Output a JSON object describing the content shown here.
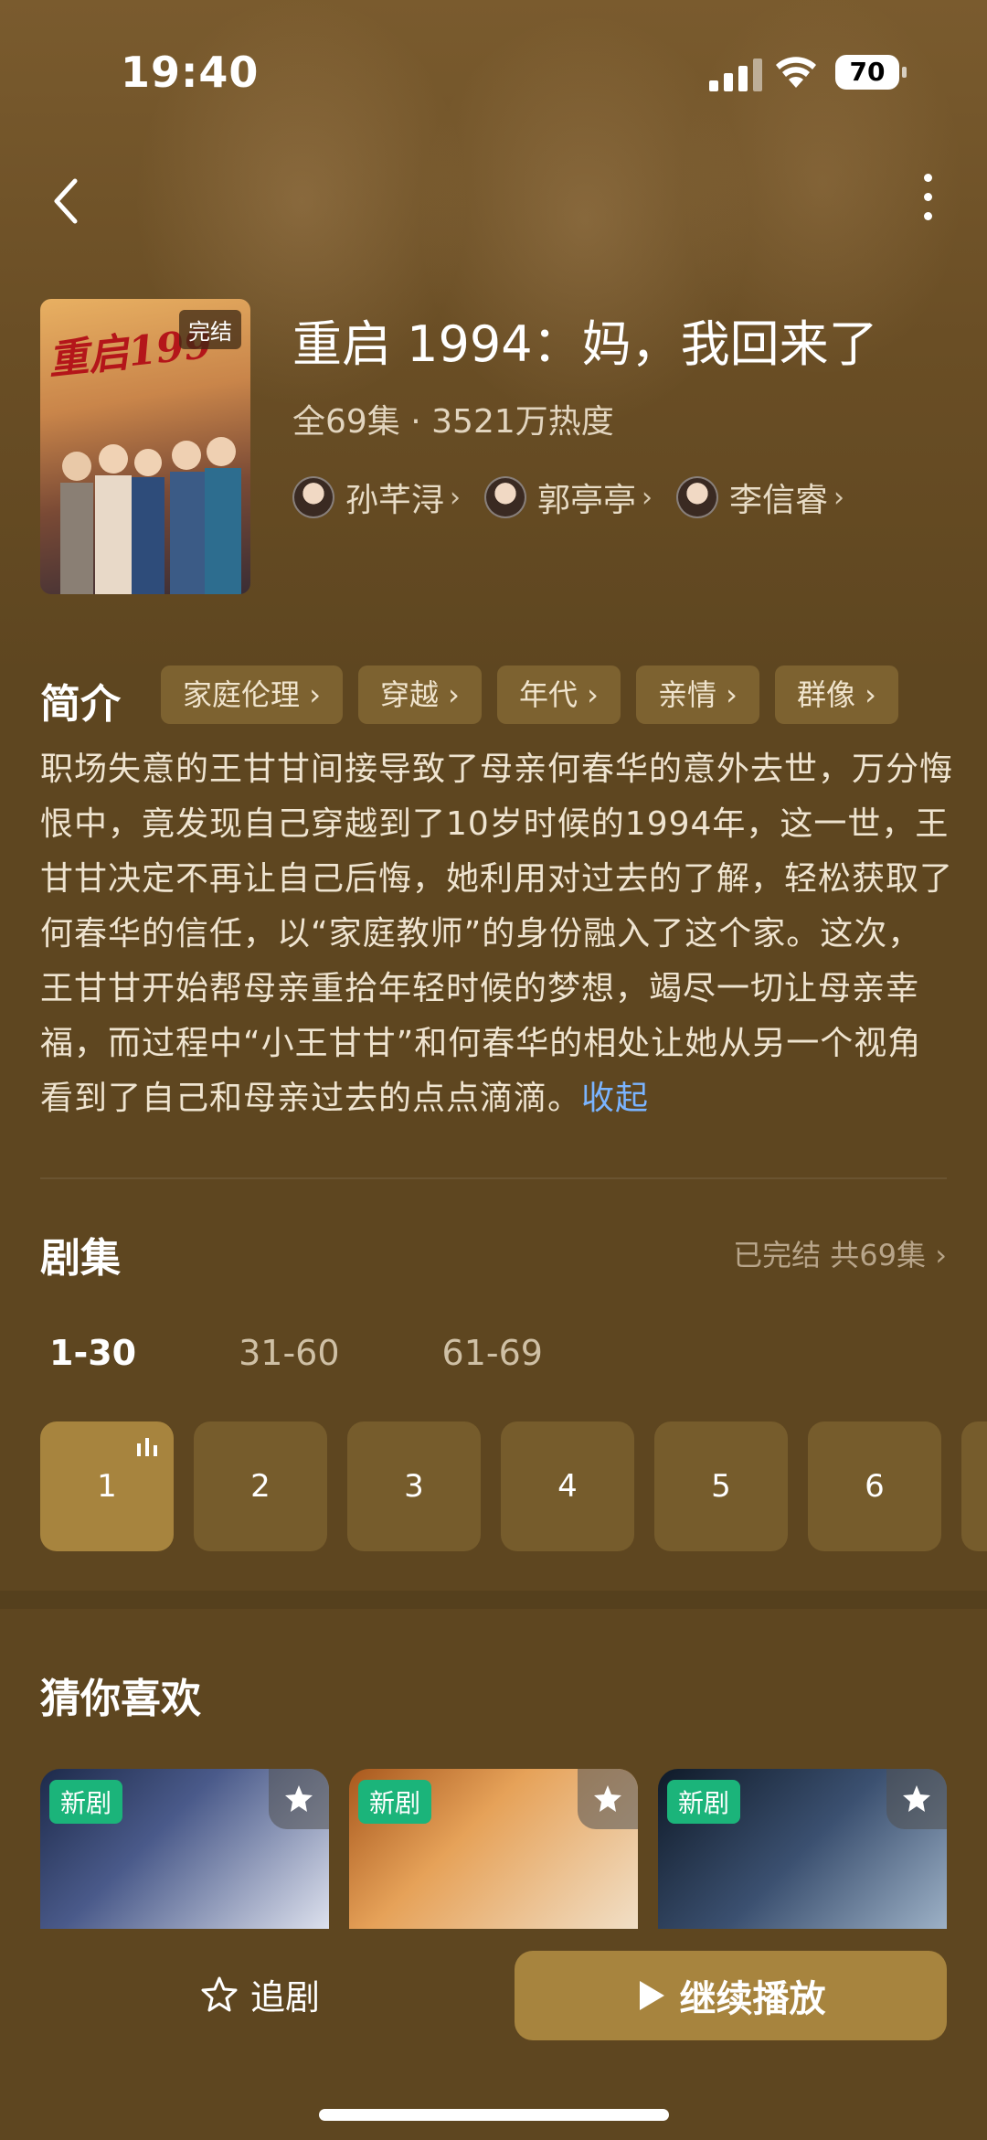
{
  "status_bar": {
    "time": "19:40",
    "battery": "70"
  },
  "drama": {
    "title": "重启 1994：妈，我回来了",
    "meta": "全69集 · 3521万热度",
    "poster_title": "重启199",
    "poster_badge": "完结",
    "cast": [
      {
        "name": "孙芊浔"
      },
      {
        "name": "郭亭亭"
      },
      {
        "name": "李信睿"
      }
    ]
  },
  "synopsis": {
    "label": "简介",
    "tags": [
      "家庭伦理",
      "穿越",
      "年代",
      "亲情",
      "群像"
    ],
    "text": "职场失意的王甘甘间接导致了母亲何春华的意外去世，万分悔恨中，竟发现自己穿越到了10岁时候的1994年，这一世，王甘甘决定不再让自己后悔，她利用对过去的了解，轻松获取了何春华的信任，以“家庭教师”的身份融入了这个家。这次，王甘甘开始帮母亲重拾年轻时候的梦想，竭尽一切让母亲幸福，而过程中“小王甘甘”和何春华的相处让她从另一个视角看到了自己和母亲过去的点点滴滴。",
    "collapse": "收起"
  },
  "episodes": {
    "label": "剧集",
    "status": "已完结 共69集",
    "ranges": [
      "1-30",
      "31-60",
      "61-69"
    ],
    "items": [
      "1",
      "2",
      "3",
      "4",
      "5",
      "6"
    ]
  },
  "recommend": {
    "label": "猜你喜欢",
    "badge": "新剧"
  },
  "actions": {
    "follow": "追剧",
    "play": "继续播放"
  },
  "colors": {
    "accent": "#a7843e",
    "background": "#5e4620",
    "new_badge": "#1bb47a",
    "link": "#7ab4ff"
  }
}
